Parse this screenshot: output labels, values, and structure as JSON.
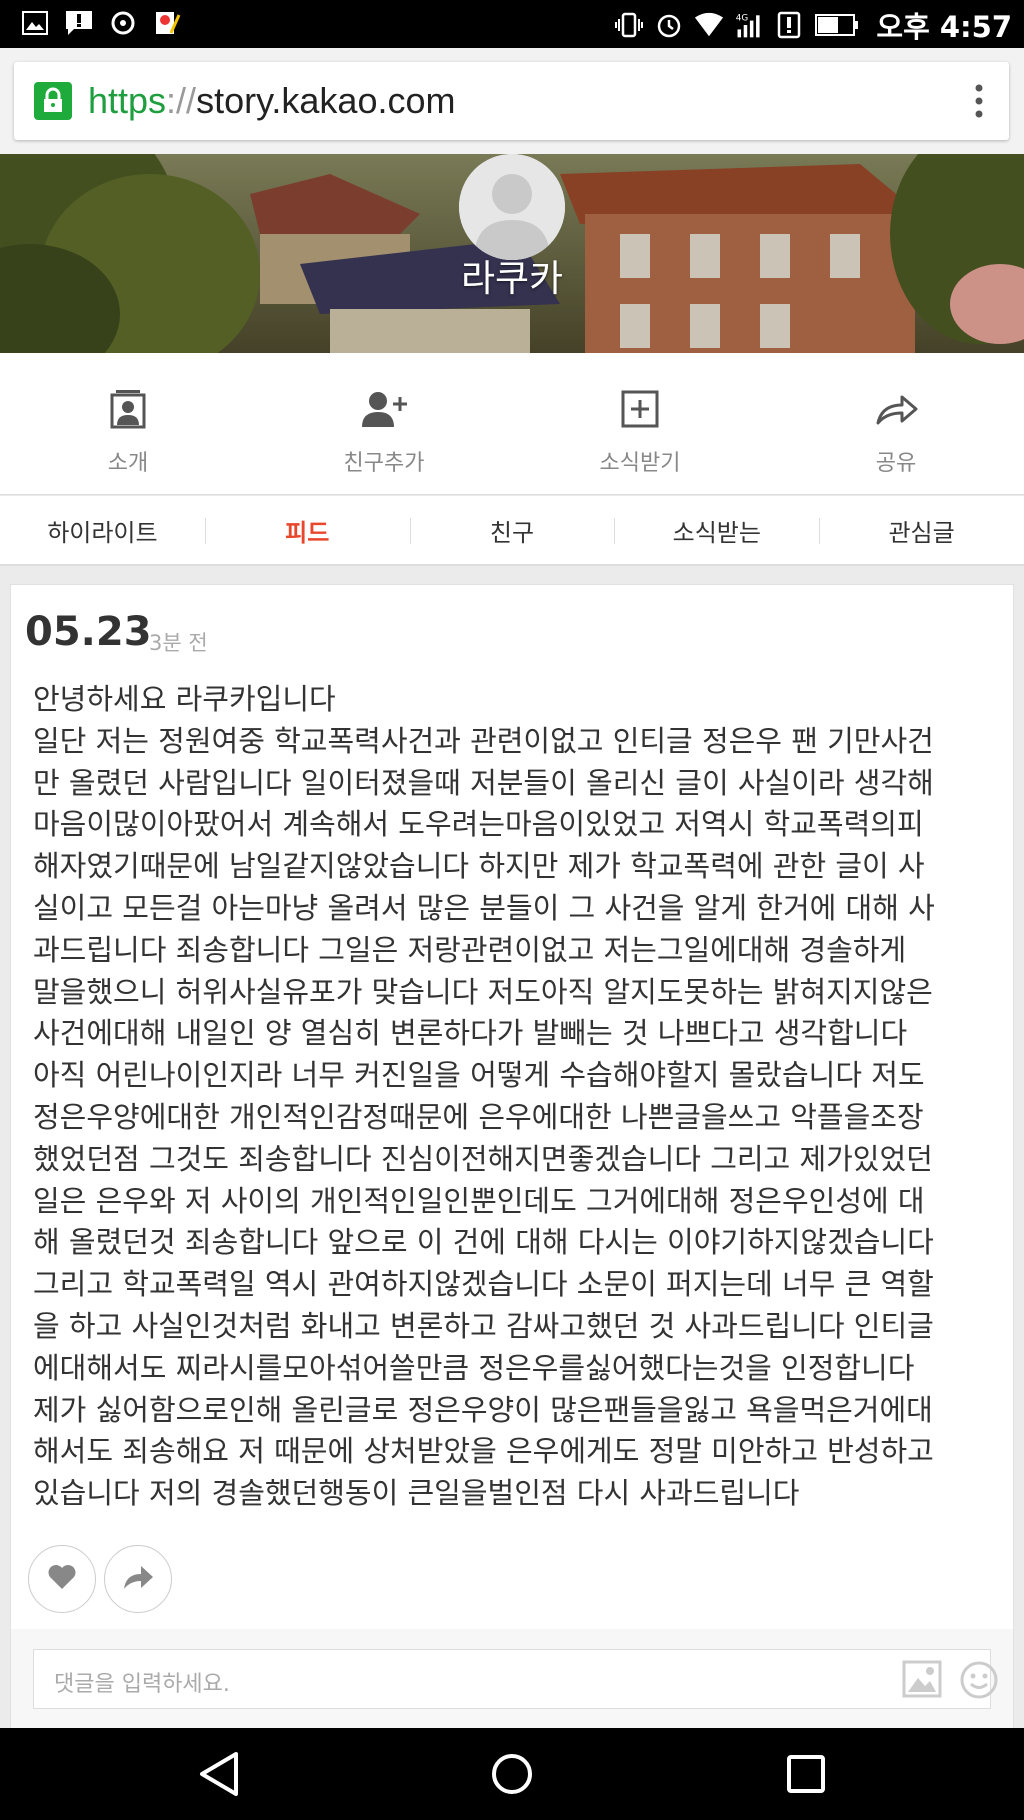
{
  "status_bar": {
    "time": "오후 4:57",
    "icons_left": [
      "image-icon",
      "alert-icon",
      "sync-icon",
      "app-icon"
    ],
    "icons_right": [
      "vibrate-icon",
      "alarm-icon",
      "wifi-icon",
      "signal-4g-icon",
      "alert-icon",
      "battery-icon"
    ]
  },
  "browser": {
    "url_scheme": "https",
    "url_separator": "://",
    "url_host": "story.kakao.com",
    "secure_color": "#1faa3c"
  },
  "profile": {
    "name": "라쿠카"
  },
  "actions": [
    {
      "label": "소개",
      "icon": "profile-card-icon"
    },
    {
      "label": "친구추가",
      "icon": "add-friend-icon"
    },
    {
      "label": "소식받기",
      "icon": "plus-box-icon"
    },
    {
      "label": "공유",
      "icon": "share-icon"
    }
  ],
  "tabs": [
    {
      "label": "하이라이트",
      "active": false
    },
    {
      "label": "피드",
      "active": true
    },
    {
      "label": "친구",
      "active": false
    },
    {
      "label": "소식받는",
      "active": false
    },
    {
      "label": "관심글",
      "active": false
    }
  ],
  "accent_color": "#e8472b",
  "post": {
    "date": "05.23",
    "time_ago": "3분 전",
    "lines": [
      "안녕하세요 라쿠카입니다",
      "일단 저는 정원여중 학교폭력사건과 관련이없고 인티글 정은우 팬 기만사건",
      "만 올렸던 사람입니다 일이터졌을때 저분들이 올리신 글이 사실이라 생각해",
      "마음이많이아팠어서 계속해서 도우려는마음이있었고 저역시 학교폭력의피",
      "해자였기때문에 남일같지않았습니다 하지만 제가 학교폭력에 관한 글이 사",
      "실이고 모든걸 아는마냥 올려서 많은 분들이 그 사건을 알게 한거에 대해 사",
      "과드립니다 죄송합니다 그일은 저랑관련이없고 저는그일에대해 경솔하게",
      "말을했으니 허위사실유포가 맞습니다 저도아직 알지도못하는 밝혀지지않은",
      "사건에대해 내일인 양 열심히 변론하다가 발빼는 것 나쁘다고 생각합니다",
      "아직 어린나이인지라 너무 커진일을 어떻게 수습해야할지 몰랐습니다 저도",
      "정은우양에대한 개인적인감정때문에 은우에대한 나쁜글을쓰고 악플을조장",
      "했었던점 그것도 죄송합니다 진심이전해지면좋겠습니다 그리고 제가있었던",
      "일은 은우와 저 사이의 개인적인일인뿐인데도 그거에대해 정은우인성에 대",
      "해 올렸던것 죄송합니다 앞으로 이 건에 대해 다시는 이야기하지않겠습니다",
      "그리고 학교폭력일 역시 관여하지않겠습니다 소문이 퍼지는데 너무 큰 역할",
      "을 하고 사실인것처럼 화내고 변론하고 감싸고했던 것 사과드립니다 인티글",
      "에대해서도 찌라시를모아섞어쓸만큼 정은우를싫어했다는것을 인정합니다",
      "제가 싫어함으로인해 올린글로 정은우양이 많은팬들을잃고 욕을먹은거에대",
      "해서도 죄송해요 저 때문에 상처받았을 은우에게도 정말 미안하고 반성하고",
      "있습니다 저의 경솔했던행동이 큰일을벌인점 다시 사과드립니다"
    ]
  },
  "comment": {
    "placeholder": "댓글을 입력하세요."
  }
}
